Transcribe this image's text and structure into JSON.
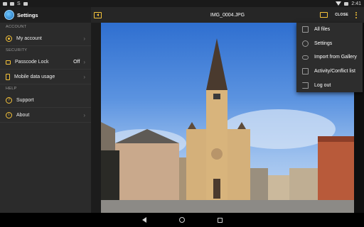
{
  "status_bar": {
    "left_indicator": "S",
    "time": "2:41"
  },
  "sidebar": {
    "title": "Settings",
    "sections": [
      {
        "label": "ACCOUNT",
        "items": [
          {
            "label": "My account",
            "icon": "user-icon",
            "value": ""
          }
        ]
      },
      {
        "label": "SECURITY",
        "items": [
          {
            "label": "Passcode Lock",
            "icon": "lock-icon",
            "value": "Off"
          },
          {
            "label": "Mobile data usage",
            "icon": "phone-icon",
            "value": ""
          }
        ]
      },
      {
        "label": "HELP",
        "items": [
          {
            "label": "Support",
            "icon": "question-icon",
            "value": ""
          },
          {
            "label": "About",
            "icon": "info-icon",
            "value": ""
          }
        ]
      }
    ]
  },
  "toolbar": {
    "title": "IMG_0004.JPG",
    "close_label": "CLOSE"
  },
  "overflow_menu": {
    "items": [
      {
        "label": "All files",
        "icon": "files-icon"
      },
      {
        "label": "Settings",
        "icon": "gear-icon"
      },
      {
        "label": "Import from Gallery",
        "icon": "cloud-icon"
      },
      {
        "label": "Activity/Conflict list",
        "icon": "list-icon"
      },
      {
        "label": "Log out",
        "icon": "logout-icon"
      }
    ]
  },
  "colors": {
    "accent": "#f5c23a",
    "sidebar_bg": "#2b2b2b",
    "menu_bg": "#2d2d2d"
  }
}
